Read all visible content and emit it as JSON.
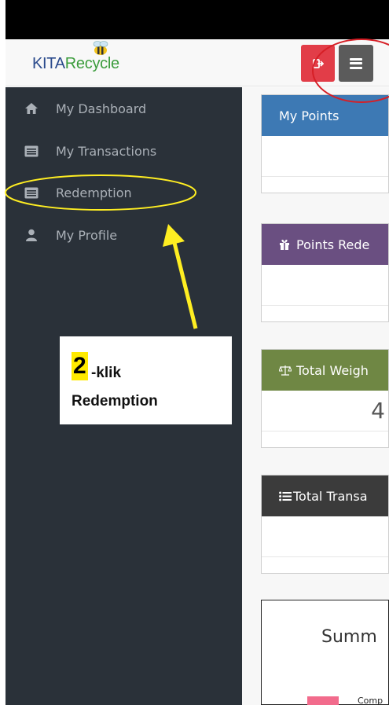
{
  "app": {
    "logo_kita": "KITA",
    "logo_recycle": "Recycle"
  },
  "navbar": {
    "logout_icon": "logout-icon",
    "menu_icon": "hamburger-menu-icon",
    "logout_color": "#e23d48",
    "menu_color": "#5b5b5b"
  },
  "sidebar": {
    "items": [
      {
        "label": "My Dashboard",
        "icon": "home-icon"
      },
      {
        "label": "My Transactions",
        "icon": "list-icon"
      },
      {
        "label": "Redemption",
        "icon": "list-icon"
      },
      {
        "label": "My Profile",
        "icon": "user-icon"
      }
    ]
  },
  "panels": [
    {
      "title": "My Points",
      "color": "#3d79b4",
      "value": ""
    },
    {
      "title": "Points Rede",
      "icon": "gift-icon",
      "color": "#6a4f81",
      "value": ""
    },
    {
      "title": "Total Weigh",
      "icon": "scale-icon",
      "color": "#6f8744",
      "value": "4"
    },
    {
      "title": "Total Transa",
      "icon": "list-ul-icon",
      "color": "#3b3b3b",
      "value": ""
    }
  ],
  "summary": {
    "title": "Summ",
    "legend_label": "Comp",
    "legend_color": "#f26b8c"
  },
  "annotation": {
    "step_number": "2",
    "step_suffix": "-klik",
    "step_target": "Redemption",
    "highlight_color": "#ffea00",
    "circle_color": "#d61f26",
    "arrow_color": "#ffee22"
  }
}
